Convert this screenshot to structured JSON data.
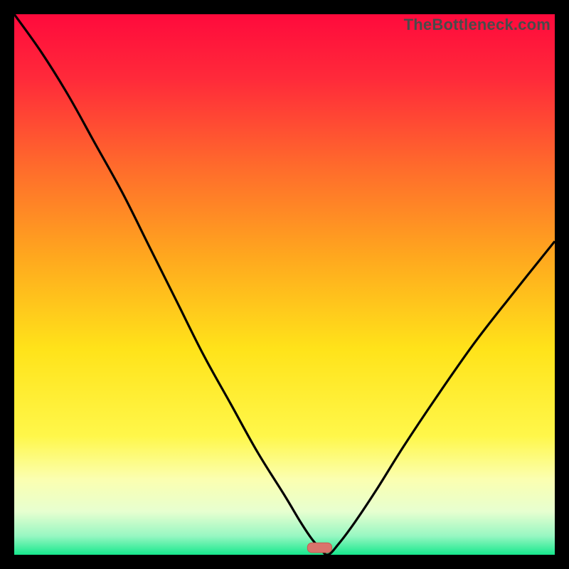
{
  "watermark": "TheBottleneck.com",
  "colors": {
    "frame": "#000000",
    "gradient_stops": [
      {
        "offset": 0.0,
        "color": "#ff0a3c"
      },
      {
        "offset": 0.12,
        "color": "#ff2a3a"
      },
      {
        "offset": 0.28,
        "color": "#ff6a2c"
      },
      {
        "offset": 0.45,
        "color": "#ffa81e"
      },
      {
        "offset": 0.62,
        "color": "#ffe31a"
      },
      {
        "offset": 0.78,
        "color": "#fff74a"
      },
      {
        "offset": 0.86,
        "color": "#fbffb0"
      },
      {
        "offset": 0.92,
        "color": "#e7ffd0"
      },
      {
        "offset": 0.965,
        "color": "#98f7c2"
      },
      {
        "offset": 1.0,
        "color": "#17e88d"
      }
    ],
    "curve": "#000000",
    "marker_fill": "#d9746c",
    "marker_stroke": "#c55a52"
  },
  "chart_data": {
    "type": "line",
    "title": "",
    "xlabel": "",
    "ylabel": "",
    "xlim": [
      0,
      100
    ],
    "ylim": [
      0,
      100
    ],
    "series": [
      {
        "name": "bottleneck-curve",
        "x": [
          0,
          5,
          10,
          15,
          20,
          25,
          30,
          35,
          40,
          45,
          50,
          53,
          55,
          56.5,
          58,
          60,
          63,
          67,
          72,
          78,
          85,
          92,
          100
        ],
        "values": [
          100,
          93,
          85,
          76,
          67,
          57,
          47,
          37,
          28,
          19,
          11,
          6,
          3,
          1.3,
          0,
          2,
          6,
          12,
          20,
          29,
          39,
          48,
          58
        ]
      }
    ],
    "marker": {
      "x": 56.5,
      "y": 1.3,
      "w": 4.5,
      "h": 1.8
    }
  }
}
